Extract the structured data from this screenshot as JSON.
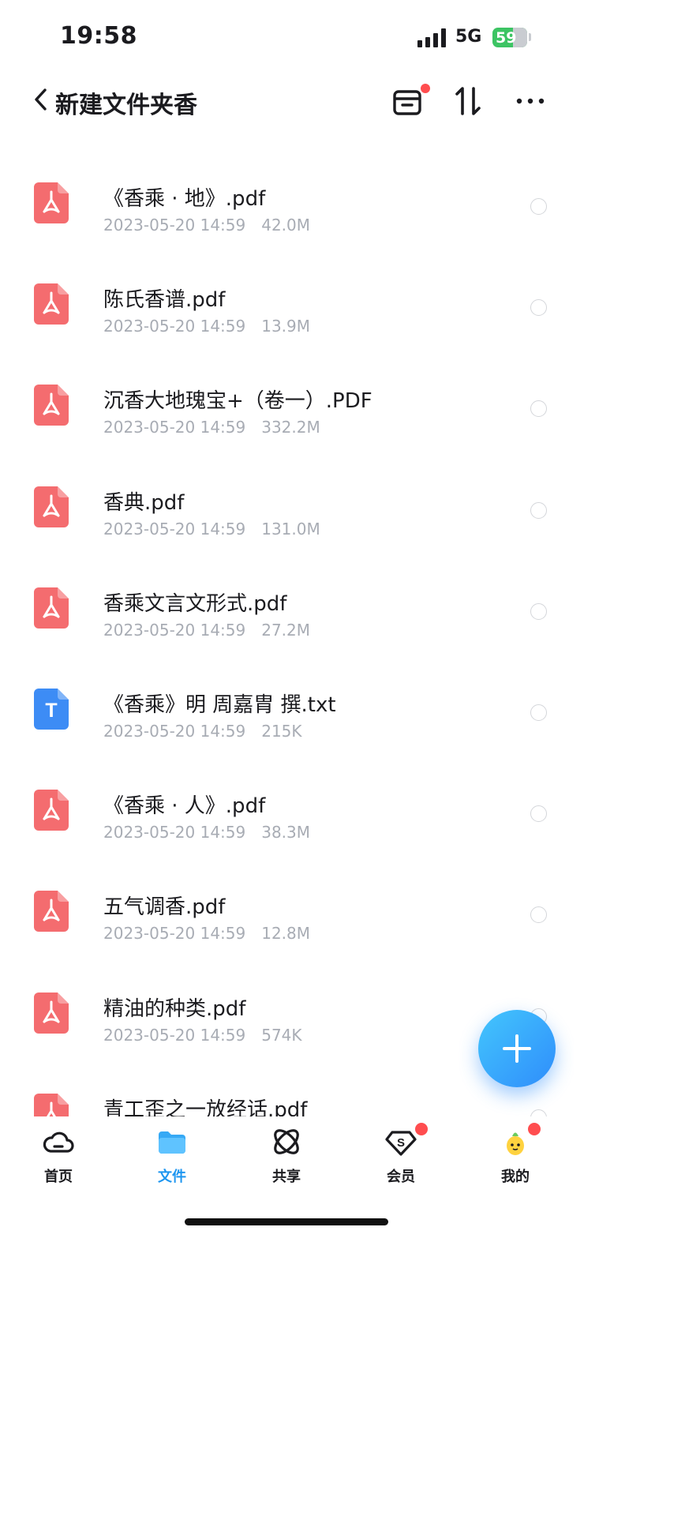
{
  "status_bar": {
    "time": "19:58",
    "network": "5G",
    "battery": "59"
  },
  "header": {
    "title": "新建文件夹香"
  },
  "files": [
    {
      "name": "《香乘 · 地》.pdf",
      "date": "2023-05-20 14:59",
      "size": "42.0M",
      "type": "pdf"
    },
    {
      "name": "陈氏香谱.pdf",
      "date": "2023-05-20 14:59",
      "size": "13.9M",
      "type": "pdf"
    },
    {
      "name": "沉香大地瑰宝+（卷一）.PDF",
      "date": "2023-05-20 14:59",
      "size": "332.2M",
      "type": "pdf"
    },
    {
      "name": "香典.pdf",
      "date": "2023-05-20 14:59",
      "size": "131.0M",
      "type": "pdf"
    },
    {
      "name": "香乘文言文形式.pdf",
      "date": "2023-05-20 14:59",
      "size": "27.2M",
      "type": "pdf"
    },
    {
      "name": "《香乘》明 周嘉胄 撰.txt",
      "date": "2023-05-20 14:59",
      "size": "215K",
      "type": "txt"
    },
    {
      "name": "《香乘 · 人》.pdf",
      "date": "2023-05-20 14:59",
      "size": "38.3M",
      "type": "pdf"
    },
    {
      "name": "五气调香.pdf",
      "date": "2023-05-20 14:59",
      "size": "12.8M",
      "type": "pdf"
    },
    {
      "name": "精油的种类.pdf",
      "date": "2023-05-20 14:59",
      "size": "574K",
      "type": "pdf"
    },
    {
      "name": "青工歪之一放经话.pdf",
      "date": "",
      "size": "",
      "type": "pdf"
    }
  ],
  "tabs": [
    {
      "label": "首页",
      "icon": "cloud-icon",
      "active": false
    },
    {
      "label": "文件",
      "icon": "folder-icon",
      "active": true
    },
    {
      "label": "共享",
      "icon": "share-orbit-icon",
      "active": false
    },
    {
      "label": "会员",
      "icon": "vip-diamond-icon",
      "active": false
    },
    {
      "label": "我的",
      "icon": "mascot-avatar-icon",
      "active": false
    }
  ],
  "colors": {
    "accent": "#1e96f0",
    "pdf_icon": "#f46c6f",
    "txt_icon": "#3d8cf5",
    "badge": "#ff4d4f",
    "battery": "#3cc463"
  }
}
